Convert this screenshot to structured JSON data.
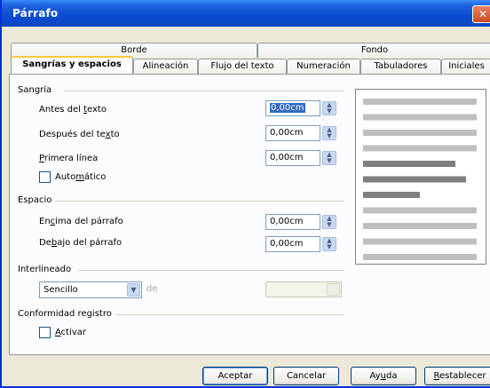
{
  "window": {
    "title": "Párrafo"
  },
  "tabs_row1": [
    {
      "label": "Borde"
    },
    {
      "label": "Fondo"
    }
  ],
  "tabs_row2": [
    {
      "label": "Sangrías y espacios"
    },
    {
      "label": "Alineación"
    },
    {
      "label": "Flujo del texto"
    },
    {
      "label": "Numeración"
    },
    {
      "label": "Tabuladores"
    },
    {
      "label": "Iniciales"
    }
  ],
  "indent": {
    "section": "Sangría",
    "before_pre": "Antes del ",
    "before_u": "t",
    "before_post": "exto",
    "before_value": "0,00cm",
    "after_pre": "Después del te",
    "after_u": "x",
    "after_post": "to",
    "after_value": "0,00cm",
    "first_pre": "",
    "first_u": "P",
    "first_post": "rimera línea",
    "first_value": "0,00cm",
    "auto_pre": "Auto",
    "auto_u": "m",
    "auto_post": "ático",
    "auto_checked": false
  },
  "spacing": {
    "section": "Espacio",
    "above_pre": "En",
    "above_u": "c",
    "above_post": "ima del párrafo",
    "above_value": "0,00cm",
    "below_pre": "De",
    "below_u": "b",
    "below_post": "ajo del párrafo",
    "below_value": "0,00cm"
  },
  "line_spacing": {
    "section": "Interlineado",
    "selected": "Sencillo",
    "de_label": "de",
    "value": ""
  },
  "register": {
    "section": "Conformidad registro",
    "activate_pre": "",
    "activate_u": "A",
    "activate_post": "ctivar",
    "checked": false
  },
  "preview": {
    "lines": [
      "light",
      "light",
      "light",
      "light",
      "dark",
      "dark",
      "dark",
      "light",
      "light",
      "light",
      "light"
    ]
  },
  "buttons": {
    "ok": "Aceptar",
    "cancel": "Cancelar",
    "help_pre": "Ay",
    "help_u": "u",
    "help_post": "da",
    "reset_pre": "",
    "reset_u": "R",
    "reset_post": "establecer"
  },
  "colors": {
    "title_bar": "#0a4ccf",
    "preview_light": "#bfbfbf",
    "preview_dark": "#7f7f7f",
    "selection": "#316ac5"
  }
}
